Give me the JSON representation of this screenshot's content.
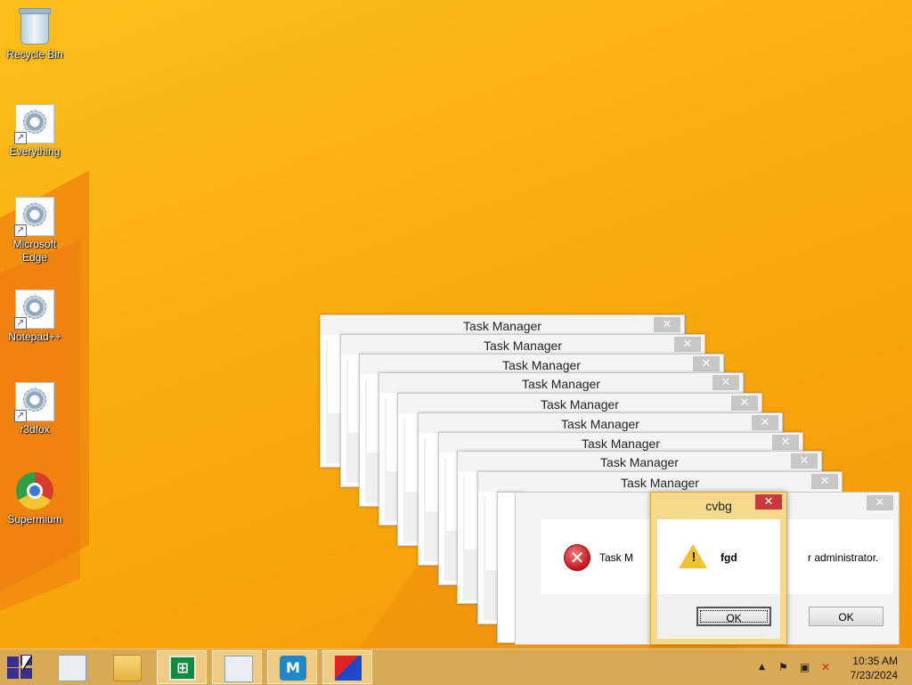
{
  "desktop": {
    "icons": [
      {
        "label": "Recycle Bin",
        "icon": "recycle-bin-icon"
      },
      {
        "label": "Everything",
        "icon": "app-gear-icon"
      },
      {
        "label": "Microsoft Edge",
        "icon": "app-gear-icon"
      },
      {
        "label": "Notepad++",
        "icon": "app-gear-icon"
      },
      {
        "label": "r3dfox",
        "icon": "app-gear-icon"
      },
      {
        "label": "Supermium",
        "icon": "chrome-icon"
      }
    ]
  },
  "dialogs": {
    "stack_title": "Task Manager",
    "close_glyph": "✕",
    "error": {
      "text_left": "Task M",
      "text_right": "r administrator.",
      "ok_label": "OK"
    },
    "cvbg": {
      "title": "cvbg",
      "message": "fgd",
      "ok_label": "OK"
    }
  },
  "taskbar": {
    "start_icon": "windows-logo-icon",
    "apps": [
      {
        "name": "task-manager-icon",
        "active": false
      },
      {
        "name": "file-explorer-icon",
        "active": false
      },
      {
        "name": "store-icon",
        "active": true
      },
      {
        "name": "system-monitor-icon",
        "active": true
      },
      {
        "name": "malwarebytes-icon",
        "active": true
      },
      {
        "name": "r3d-app-icon",
        "active": true
      }
    ],
    "tray": {
      "show_hidden_glyph": "▲",
      "time": "10:35 AM",
      "date": "7/23/2024"
    }
  }
}
